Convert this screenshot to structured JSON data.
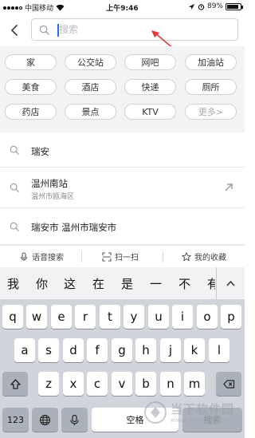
{
  "status_bar": {
    "carrier": "中国移动",
    "time": "上午9:46",
    "battery_percent": "89%",
    "battery_level": 0.89
  },
  "search": {
    "placeholder": "搜索",
    "back_icon": "chevron-left-icon",
    "search_icon": "search-icon"
  },
  "categories": [
    "家",
    "公交站",
    "网吧",
    "加油站",
    "美食",
    "酒店",
    "快递",
    "厕所",
    "药店",
    "景点",
    "KTV",
    "更多>"
  ],
  "history": [
    {
      "title": "瑞安",
      "subtitle": ""
    },
    {
      "title": "温州南站",
      "subtitle": "温州市瓯海区"
    },
    {
      "title": "瑞安市 温州市瑞安市",
      "subtitle": ""
    }
  ],
  "tools": {
    "voice_search": "语音搜索",
    "scan": "扫一扫",
    "favorites": "我的收藏"
  },
  "keyboard": {
    "candidates": [
      "我",
      "你",
      "这",
      "在",
      "是",
      "一",
      "不",
      "有"
    ],
    "row1": [
      "q",
      "w",
      "e",
      "r",
      "t",
      "y",
      "u",
      "i",
      "o",
      "p"
    ],
    "row2": [
      "a",
      "s",
      "d",
      "f",
      "g",
      "h",
      "j",
      "k",
      "l"
    ],
    "row3": [
      "z",
      "x",
      "c",
      "v",
      "b",
      "n",
      "m"
    ],
    "numbers_key": "123",
    "space_key": "空格",
    "search_key": "搜索"
  },
  "watermark": {
    "text": "当下软件园",
    "url": "www.downxia.com"
  }
}
